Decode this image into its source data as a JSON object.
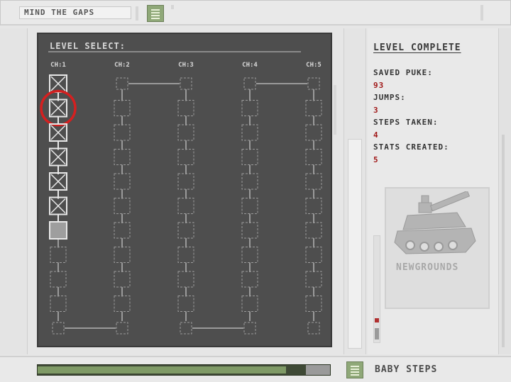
{
  "app": {
    "title": "MIND THE GAPS",
    "current_level_name": "BABY STEPS",
    "progress_fraction": 0.85
  },
  "level_select": {
    "heading": "LEVEL SELECT:",
    "chapters": [
      "CH:1",
      "CH:2",
      "CH:3",
      "CH:4",
      "CH:5"
    ],
    "levels_per_chapter": 11,
    "completed_levels_ch1": 6,
    "current_level_index": 6,
    "highlighted_level_index": 1,
    "colors": {
      "panel": "#4e4e4e",
      "completed": "#e8e8e8",
      "locked": "#9a9a9a",
      "current_fill": "#9e9e9e",
      "highlight_ring": "#d42020"
    }
  },
  "level_complete": {
    "title": "LEVEL COMPLETE",
    "stats": [
      {
        "label": "SAVED PUKE:",
        "value": "93"
      },
      {
        "label": "JUMPS:",
        "value": "3"
      },
      {
        "label": "STEPS TAKEN:",
        "value": "4"
      },
      {
        "label": "STATS CREATED:",
        "value": "5"
      }
    ]
  },
  "sponsor": {
    "logo_text": "NEWGROUNDS",
    "logo_icon": "tank-icon"
  },
  "icons": {
    "menu": "menu-grid-icon",
    "bottom": "menu-grid-icon"
  }
}
